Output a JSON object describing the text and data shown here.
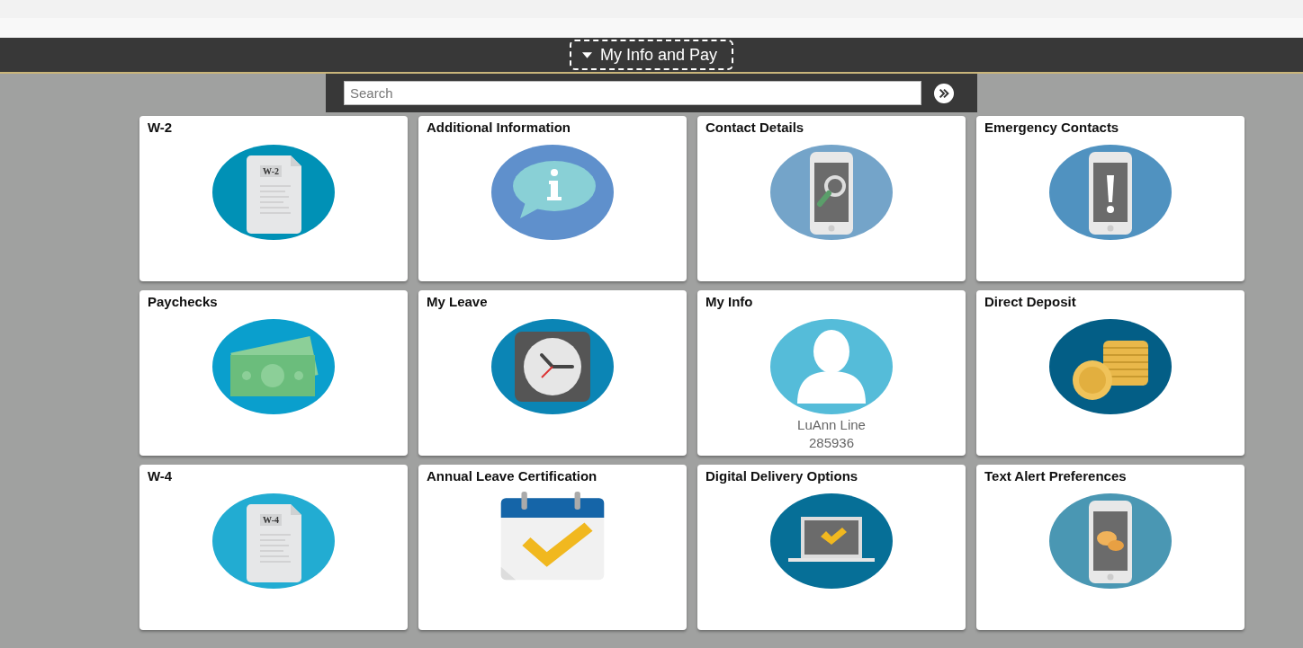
{
  "header": {
    "title": "My Info and Pay"
  },
  "search": {
    "placeholder": "Search"
  },
  "tiles": [
    {
      "title": "W-2",
      "kind": "document",
      "color": "#0091b6",
      "doc_label": "W-2"
    },
    {
      "title": "Additional Information",
      "kind": "info",
      "color": "#5f90cc"
    },
    {
      "title": "Contact Details",
      "kind": "phone-search",
      "color": "#74a4c9"
    },
    {
      "title": "Emergency Contacts",
      "kind": "phone-alert",
      "color": "#5092c0"
    },
    {
      "title": "Paychecks",
      "kind": "money",
      "color": "#0a9fcd"
    },
    {
      "title": "My Leave",
      "kind": "clock",
      "color": "#0b85b5"
    },
    {
      "title": "My Info",
      "kind": "person",
      "color": "#55bcd9",
      "name": "LuAnn Line",
      "id": "285936"
    },
    {
      "title": "Direct Deposit",
      "kind": "coins",
      "color": "#035e86"
    },
    {
      "title": "W-4",
      "kind": "document",
      "color": "#22acd2",
      "doc_label": "W-4"
    },
    {
      "title": "Annual Leave Certification",
      "kind": "calendar",
      "color": "#1565a8"
    },
    {
      "title": "Digital Delivery Options",
      "kind": "laptop",
      "color": "#066f97"
    },
    {
      "title": "Text Alert Preferences",
      "kind": "phone-chat",
      "color": "#4a97b3"
    }
  ]
}
